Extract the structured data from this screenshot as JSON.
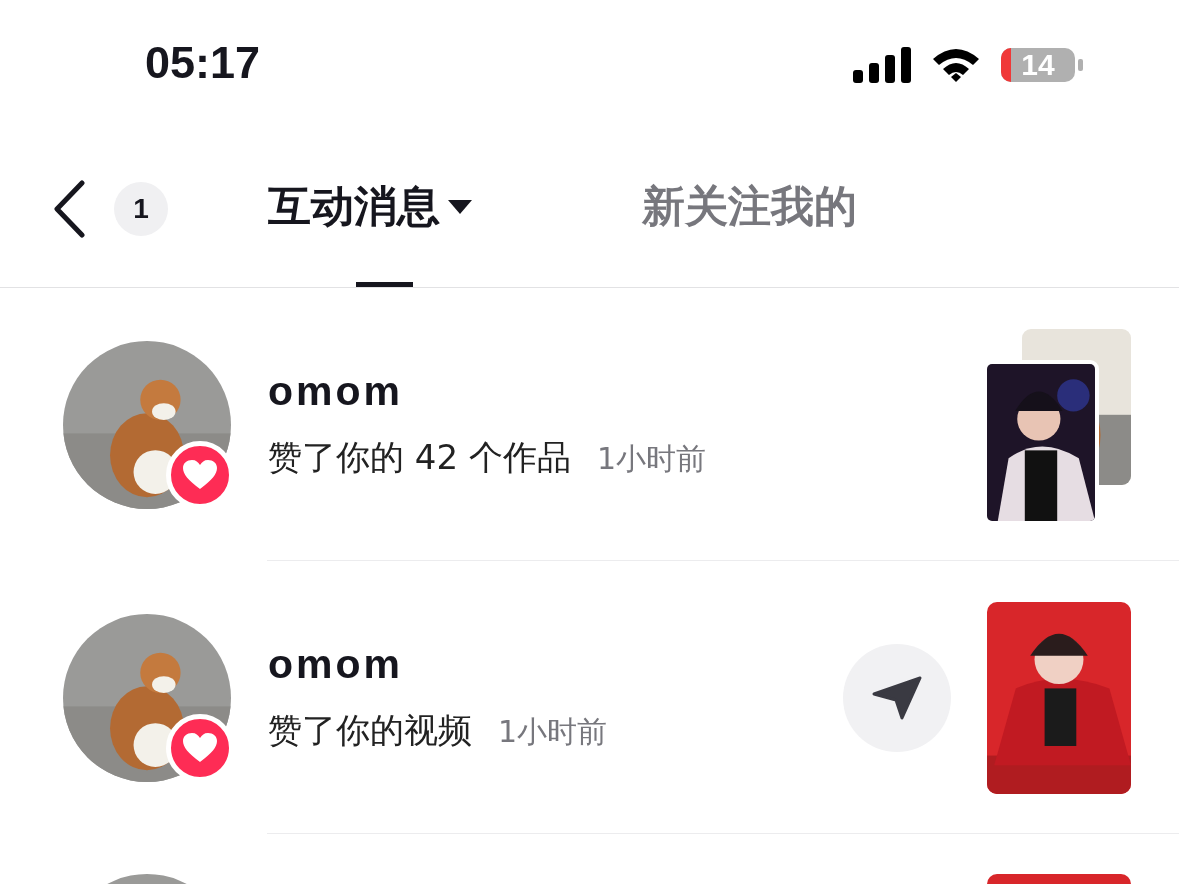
{
  "status_bar": {
    "time": "05:17",
    "battery": "14"
  },
  "header": {
    "unread": "1",
    "tabs": [
      {
        "label": "互动消息",
        "selected": true,
        "menu": true
      },
      {
        "label": "新关注我的",
        "selected": false,
        "menu": false
      }
    ]
  },
  "notifications": [
    {
      "name": "omom",
      "action": "赞了你的 42 个作品",
      "time": "1小时前",
      "liked": true,
      "stacked": true,
      "share": false
    },
    {
      "name": "omom",
      "action": "赞了你的视频",
      "time": "1小时前",
      "liked": true,
      "stacked": false,
      "share": true
    },
    {
      "stacked": false
    }
  ]
}
